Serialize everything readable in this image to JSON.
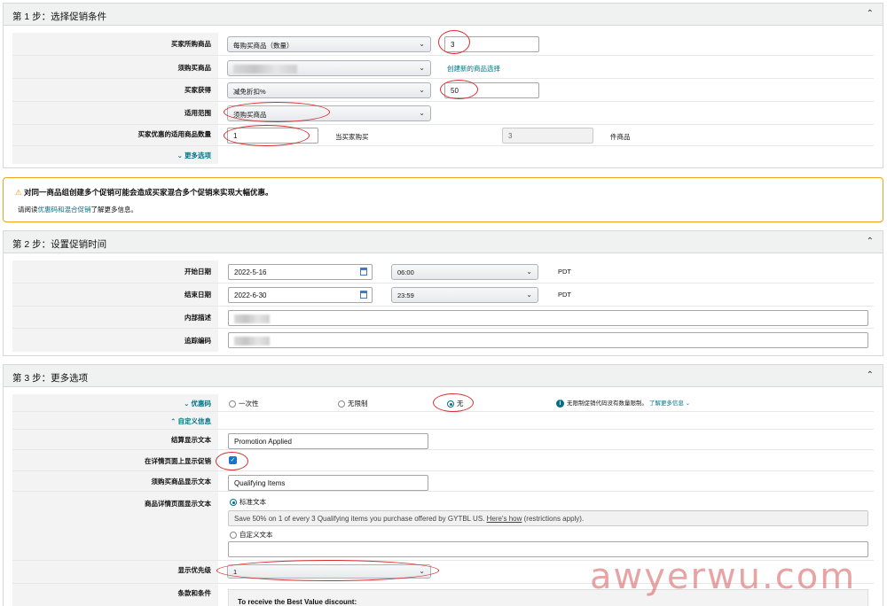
{
  "step1": {
    "title": "第 1 步：选择促销条件",
    "rows": {
      "buyer_purchases_label": "买家所购商品",
      "buyer_purchases_select": "每购买商品（数量）",
      "buyer_purchases_qty": "3",
      "required_items_label": "须购买商品",
      "create_selection_link": "创建新的商品选择",
      "buyer_gets_label": "买家获得",
      "buyer_gets_select": "减免折扣%",
      "buyer_gets_value": "50",
      "applies_to_label": "适用范围",
      "applies_to_select": "须购买商品",
      "discount_qty_label": "买家优惠的适用商品数量",
      "discount_qty_value": "1",
      "when_buyer_buys": "当买家购买",
      "buys_qty_value": "3",
      "items_suffix": "件商品",
      "more_options": "更多选项"
    }
  },
  "warning": {
    "title": "对同一商品组创建多个促销可能会造成买家混合多个促销来实现大幅优惠。",
    "body_prefix": "请阅读",
    "body_link": "优惠码和混合促销",
    "body_suffix": "了解更多信息。"
  },
  "step2": {
    "title": "第 2 步：设置促销时间",
    "start_label": "开始日期",
    "start_date": "2022-5-16",
    "start_time": "06:00",
    "start_tz": "PDT",
    "end_label": "结束日期",
    "end_date": "2022-6-30",
    "end_time": "23:59",
    "end_tz": "PDT",
    "internal_desc_label": "内部描述",
    "tracking_code_label": "追踪编码"
  },
  "step3": {
    "title": "第 3 步：更多选项",
    "claim_code_label": "优惠码",
    "opt_single": "一次性",
    "opt_unlimited": "无限制",
    "opt_none": "无",
    "unlimited_note": "无限制促销代码没有数量限制。",
    "learn_more": "了解更多信息",
    "custom_info": "自定义信息",
    "checkout_text_label": "结算显示文本",
    "checkout_text_value": "Promotion Applied",
    "show_on_detail_label": "在详情页面上显示促销",
    "qualifying_text_label": "须购买商品显示文本",
    "qualifying_text_value": "Qualifying Items",
    "detail_text_label": "商品详情页面显示文本",
    "standard_text_label": "标准文本",
    "standard_text_prefix": "Save 50% on 1 of every 3 Qualifying items you purchase offered by GYTBL US.",
    "standard_text_link": "Here's how",
    "standard_text_suffix": "(restrictions apply).",
    "custom_text_label": "自定义文本",
    "priority_label": "显示优先级",
    "priority_value": "1",
    "terms_label": "条款和条件",
    "terms_heading": "To receive the Best Value discount:"
  },
  "watermark": "awyerwu.com"
}
